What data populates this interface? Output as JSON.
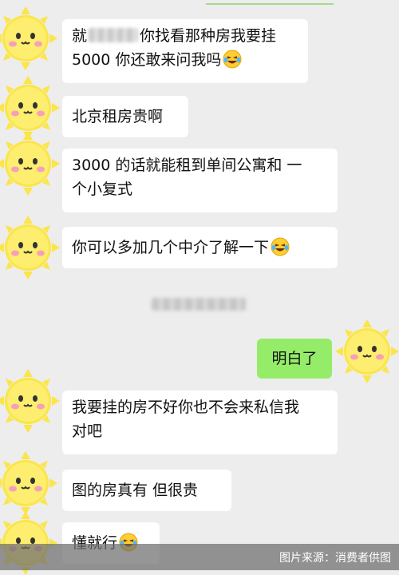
{
  "messages": [
    {
      "line1_prefix": "就",
      "line1_suffix": "你找看那种房我要挂",
      "line2": "5000 你还敢来问我吗"
    },
    {
      "text": "北京租房贵啊"
    },
    {
      "line1": "3000 的话就能租到单间公寓和 一",
      "line2": "个小复式"
    },
    {
      "text": "你可以多加几个中介了解一下"
    },
    {
      "text": "明白了"
    },
    {
      "line1": "我要挂的房不好你也不会来私信我",
      "line2": "对吧"
    },
    {
      "text": "图的房真有  但很贵"
    },
    {
      "text": "懂就行"
    }
  ],
  "footer": {
    "caption": "图片来源：消费者供图"
  },
  "colors": {
    "background": "#ededed",
    "incoming_bubble": "#ffffff",
    "outgoing_bubble": "#95ec69",
    "text": "#111111"
  },
  "icons": [
    "sun-avatar-icon",
    "laughing-crying-emoji-icon"
  ]
}
